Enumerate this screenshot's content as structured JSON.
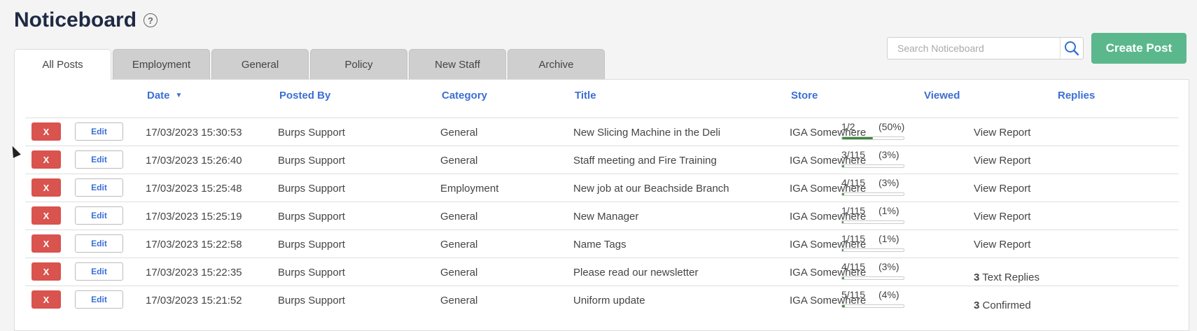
{
  "page": {
    "title": "Noticeboard"
  },
  "tabs": [
    "All Posts",
    "Employment",
    "General",
    "Policy",
    "New Staff",
    "Archive"
  ],
  "search": {
    "placeholder": "Search Noticeboard"
  },
  "create_label": "Create Post",
  "columns": {
    "date": "Date",
    "posted_by": "Posted By",
    "category": "Category",
    "title": "Title",
    "store": "Store",
    "viewed": "Viewed",
    "replies": "Replies"
  },
  "row_buttons": {
    "delete": "X",
    "edit": "Edit"
  },
  "rows": [
    {
      "date": "17/03/2023 15:30:53",
      "posted_by": "Burps Support",
      "category": "General",
      "title": "New Slicing Machine in the Deli",
      "store": "IGA Somewhere",
      "viewed_count": "1/2",
      "viewed_pct": "(50%)",
      "viewed_fraction": 0.5,
      "reply_num": "",
      "reply_text": "View Report"
    },
    {
      "date": "17/03/2023 15:26:40",
      "posted_by": "Burps Support",
      "category": "General",
      "title": "Staff meeting and Fire Training",
      "store": "IGA Somewhere",
      "viewed_count": "3/115",
      "viewed_pct": "(3%)",
      "viewed_fraction": 0.03,
      "reply_num": "",
      "reply_text": "View Report"
    },
    {
      "date": "17/03/2023 15:25:48",
      "posted_by": "Burps Support",
      "category": "Employment",
      "title": "New job at our Beachside Branch",
      "store": "IGA Somewhere",
      "viewed_count": "4/115",
      "viewed_pct": "(3%)",
      "viewed_fraction": 0.03,
      "reply_num": "",
      "reply_text": "View Report"
    },
    {
      "date": "17/03/2023 15:25:19",
      "posted_by": "Burps Support",
      "category": "General",
      "title": "New Manager",
      "store": "IGA Somewhere",
      "viewed_count": "1/115",
      "viewed_pct": "(1%)",
      "viewed_fraction": 0.01,
      "reply_num": "",
      "reply_text": "View Report"
    },
    {
      "date": "17/03/2023 15:22:58",
      "posted_by": "Burps Support",
      "category": "General",
      "title": "Name Tags",
      "store": "IGA Somewhere",
      "viewed_count": "1/115",
      "viewed_pct": "(1%)",
      "viewed_fraction": 0.01,
      "reply_num": "",
      "reply_text": "View Report"
    },
    {
      "date": "17/03/2023 15:22:35",
      "posted_by": "Burps Support",
      "category": "General",
      "title": "Please read our newsletter",
      "store": "IGA Somewhere",
      "viewed_count": "4/115",
      "viewed_pct": "(3%)",
      "viewed_fraction": 0.03,
      "reply_num": "3",
      "reply_text": "Text Replies"
    },
    {
      "date": "17/03/2023 15:21:52",
      "posted_by": "Burps Support",
      "category": "General",
      "title": "Uniform update",
      "store": "IGA Somewhere",
      "viewed_count": "5/115",
      "viewed_pct": "(4%)",
      "viewed_fraction": 0.04,
      "reply_num": "3",
      "reply_text": "Confirmed"
    }
  ]
}
